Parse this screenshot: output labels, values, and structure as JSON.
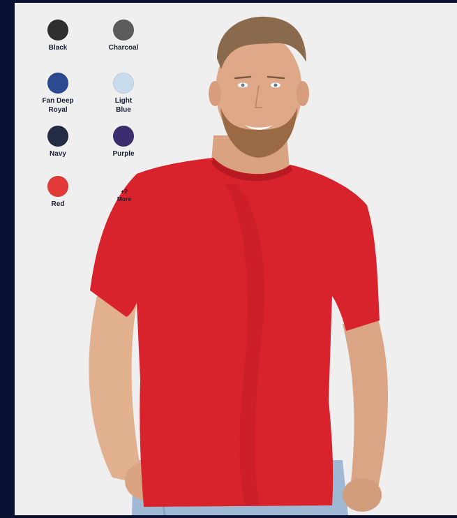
{
  "swatches": [
    {
      "label": "Black",
      "color": "#2f2f2f"
    },
    {
      "label": "Charcoal",
      "color": "#5c5c5c"
    },
    {
      "label": "Fan Deep\nRoyal",
      "color": "#2b4a92"
    },
    {
      "label": "Light\nBlue",
      "color": "#c9dcee"
    },
    {
      "label": "Navy",
      "color": "#232b45"
    },
    {
      "label": "Purple",
      "color": "#3c2e6e"
    },
    {
      "label": "Red",
      "color": "#e23a36"
    }
  ],
  "more": {
    "count": "+2",
    "label": "More"
  },
  "product": {
    "shirt_color": "#d8232d"
  }
}
